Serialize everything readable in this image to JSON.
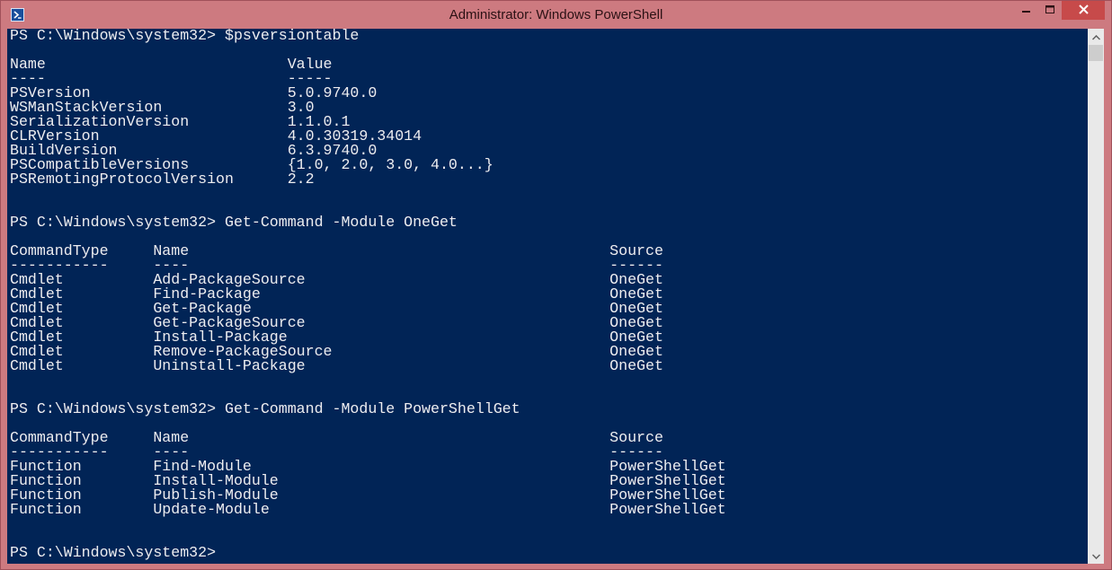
{
  "window": {
    "title": "Administrator: Windows PowerShell",
    "app_icon": "powershell-icon",
    "controls": {
      "minimize_icon": "minimize-icon",
      "maximize_icon": "maximize-icon",
      "close_icon": "close-icon"
    }
  },
  "colors": {
    "titlebar": "#cd7a80",
    "console_background": "#012456",
    "console_text": "#eeedf0",
    "close_button": "#c74a4a"
  },
  "console": {
    "lines": [
      "PS C:\\Windows\\system32> $psversiontable",
      "",
      "Name                           Value",
      "----                           -----",
      "PSVersion                      5.0.9740.0",
      "WSManStackVersion              3.0",
      "SerializationVersion           1.1.0.1",
      "CLRVersion                     4.0.30319.34014",
      "BuildVersion                   6.3.9740.0",
      "PSCompatibleVersions           {1.0, 2.0, 3.0, 4.0...}",
      "PSRemotingProtocolVersion      2.2",
      "",
      "",
      "PS C:\\Windows\\system32> Get-Command -Module OneGet",
      "",
      "CommandType     Name                                               Source",
      "-----------     ----                                               ------",
      "Cmdlet          Add-PackageSource                                  OneGet",
      "Cmdlet          Find-Package                                       OneGet",
      "Cmdlet          Get-Package                                        OneGet",
      "Cmdlet          Get-PackageSource                                  OneGet",
      "Cmdlet          Install-Package                                    OneGet",
      "Cmdlet          Remove-PackageSource                               OneGet",
      "Cmdlet          Uninstall-Package                                  OneGet",
      "",
      "",
      "PS C:\\Windows\\system32> Get-Command -Module PowerShellGet",
      "",
      "CommandType     Name                                               Source",
      "-----------     ----                                               ------",
      "Function        Find-Module                                        PowerShellGet",
      "Function        Install-Module                                     PowerShellGet",
      "Function        Publish-Module                                     PowerShellGet",
      "Function        Update-Module                                      PowerShellGet",
      "",
      "",
      "PS C:\\Windows\\system32>"
    ]
  },
  "scrollbar": {
    "up_icon": "scroll-up-arrow-icon",
    "down_icon": "scroll-down-arrow-icon"
  }
}
